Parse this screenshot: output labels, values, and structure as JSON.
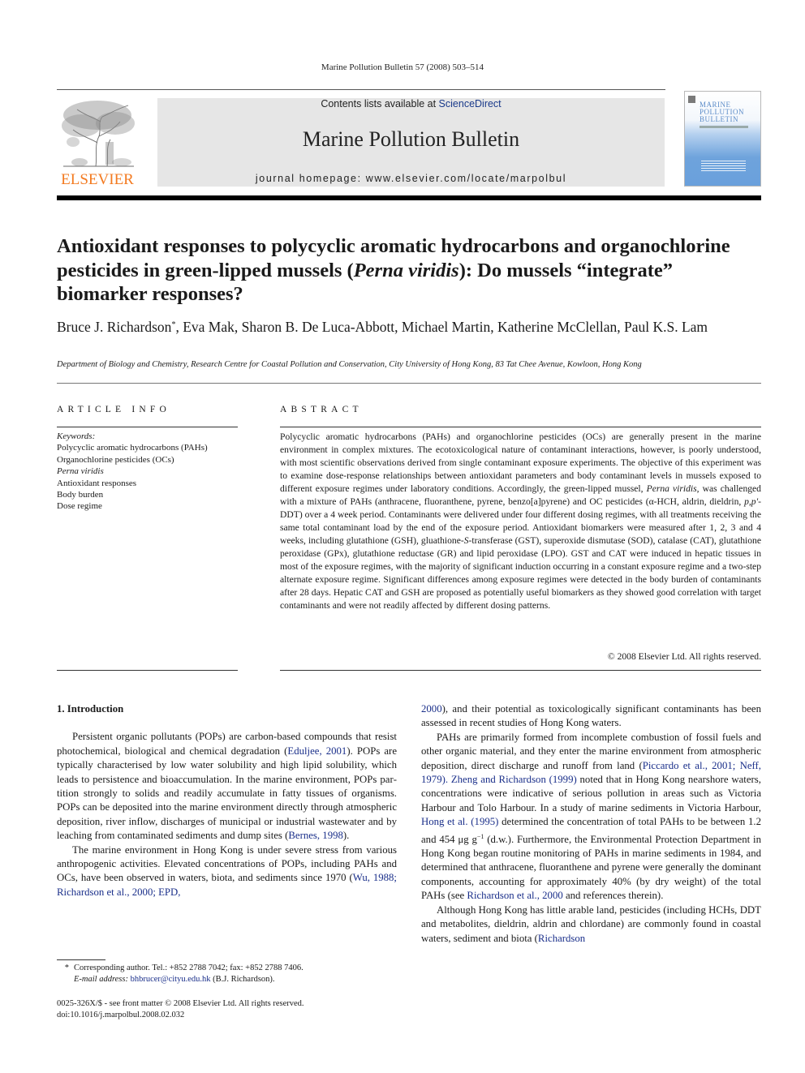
{
  "running_head": "Marine Pollution Bulletin 57 (2008) 503–514",
  "masthead": {
    "publisher_logo_text": "ELSEVIER",
    "contents_prefix": "Contents lists available at ",
    "contents_link": "ScienceDirect",
    "journal_name": "Marine Pollution Bulletin",
    "homepage": "journal homepage: www.elsevier.com/locate/marpolbul",
    "cover_title_lines": [
      "MARINE",
      "POLLUTION",
      "BULLETIN"
    ],
    "colors": {
      "elsevier_orange": "#f37a20",
      "link_blue": "#1a2f8a",
      "banner_gray": "#e6e6e6",
      "cover_blue": "#6ea3dc"
    }
  },
  "article": {
    "title_part1": "Antioxidant responses to polycyclic aromatic hydrocarbons and organochlorine pesticides in green-lipped mussels (",
    "title_italic": "Perna viridis",
    "title_part2": "): Do mussels “integrate” biomarker responses?",
    "authors_first": "Bruce J. Richardson",
    "corresponding_mark": "*",
    "authors_rest": ", Eva Mak, Sharon B. De Luca-Abbott, Michael Martin, Katherine McClellan, Paul K.S. Lam",
    "affiliation": "Department of Biology and Chemistry, Research Centre for Coastal Pollution and Conservation, City University of Hong Kong, 83 Tat Chee Avenue, Kowloon, Hong Kong"
  },
  "article_info": {
    "label": "ARTICLE INFO",
    "keywords_heading": "Keywords:",
    "keywords": [
      "Polycyclic aromatic hydrocarbons (PAHs)",
      "Organochlorine pesticides (OCs)",
      "Perna viridis",
      "Antioxidant responses",
      "Body burden",
      "Dose regime"
    ]
  },
  "abstract": {
    "label": "ABSTRACT",
    "text_1": "Polycyclic aromatic hydrocarbons (PAHs) and organochlorine pesticides (OCs) are generally present in the marine environment in complex mixtures. The ecotoxicological nature of contaminant interactions, however, is poorly understood, with most scientific observations derived from single contaminant expo­sure experiments. The objective of this experiment was to examine dose-response relationships between antioxidant parameters and body contaminant levels in mussels exposed to different exposure regimes under laboratory conditions. Accordingly, the green-lipped mussel, ",
    "text_italic_1": "Perna viridis",
    "text_2": ", was challenged with a mixture of PAHs (anthracene, fluoranthene, pyrene, benzo[a]pyrene) and OC pesticides (α-HCH, aldrin, dieldrin, ",
    "text_italic_2": "p,p′",
    "text_3": "-DDT) over a 4 week period. Contaminants were delivered under four different dosing regimes, with all treatments receiving the same total contaminant load by the end of the exposure period. Antioxidant biomarkers were measured after 1, 2, 3 and 4 weeks, including glutathione (GSH), gluathi­one-",
    "text_italic_3": "S",
    "text_4": "-transferase (GST), superoxide dismutase (SOD), catalase (CAT), glutathione peroxidase (GPx), glu­tathione reductase (GR) and lipid peroxidase (LPO). GST and CAT were induced in hepatic tissues in most of the exposure regimes, with the majority of significant induction occurring in a constant exposure regime and a two-step alternate exposure regime. Significant differences among exposure regimes were detected in the body burden of contaminants after 28 days. Hepatic CAT and GSH are proposed as poten­tially useful biomarkers as they showed good correlation with target contaminants and were not readily affected by different dosing patterns.",
    "copyright": "© 2008 Elsevier Ltd. All rights reserved."
  },
  "body": {
    "section_heading": "1. Introduction",
    "left": {
      "p1_a": "Persistent organic pollutants (POPs) are carbon-based com­pounds that resist photochemical, biological and chemical degra­dation (",
      "p1_ref1": "Eduljee, 2001",
      "p1_b": "). POPs are typically characterised by low water solubility and high lipid solubility, which leads to persis­tence and bioaccumulation. In the marine environment, POPs par­tition strongly to solids and readily accumulate in fatty tissues of organisms. POPs can be deposited into the marine environment di­rectly through atmospheric deposition, river inflow, discharges of municipal or industrial wastewater and by leaching from contam­inated sediments and dump sites (",
      "p1_ref2": "Bernes, 1998",
      "p1_c": ").",
      "p2_a": "The marine environment in Hong Kong is under severe stress from various anthropogenic activities. Elevated concentrations of POPs, including PAHs and OCs, have been observed in waters, biota, and sediments since 1970 (",
      "p2_ref": "Wu, 1988; Richardson et al., 2000; EPD,"
    },
    "right": {
      "p0_ref": "2000",
      "p0_text": "), and their potential as toxicologically significant contami­nants has been assessed in recent studies of Hong Kong waters.",
      "p1_a": "PAHs are primarily formed from incomplete combustion of fos­sil fuels and other organic material, and they enter the marine environment from atmospheric deposition, direct discharge and runoff from land (",
      "p1_ref1": "Piccardo et al., 2001; Neff, 1979). Zheng and Richardson (1999)",
      "p1_b": " noted that in Hong Kong nearshore waters, con­centrations were indicative of serious pollution in areas such as Victoria Harbour and Tolo Harbour. In a study of marine sediments in Victoria Harbour, ",
      "p1_ref2": "Hong et al. (1995)",
      "p1_c": " determined the concentra­tion of total PAHs to be between 1.2 and 454 μg g",
      "p1_sup": "−1",
      "p1_d": " (d.w.). Further­more, the Environmental Protection Department in Hong Kong began routine monitoring of PAHs in marine sediments in 1984, and determined that anthracene, fluoranthene and pyrene were generally the dominant components, accounting for approximately 40% (by dry weight) of the total PAHs (see ",
      "p1_ref3": "Richardson et al., 2000",
      "p1_e": " and references therein).",
      "p2_a": "Although Hong Kong has little arable land, pesticides (including HCHs, DDT and metabolites, dieldrin, aldrin and chlordane) are commonly found in coastal waters, sediment and biota (",
      "p2_ref": "Richardson"
    }
  },
  "footnote": {
    "star": "*",
    "line1": "Corresponding author. Tel.: +852 2788 7042; fax: +852 2788 7406.",
    "email_label": "E-mail address:",
    "email": "bhbrucer@cityu.edu.hk",
    "email_suffix": " (B.J. Richardson)."
  },
  "issn_line": "0025-326X/$ - see front matter © 2008 Elsevier Ltd. All rights reserved.",
  "doi_line": "doi:10.1016/j.marpolbul.2008.02.032"
}
